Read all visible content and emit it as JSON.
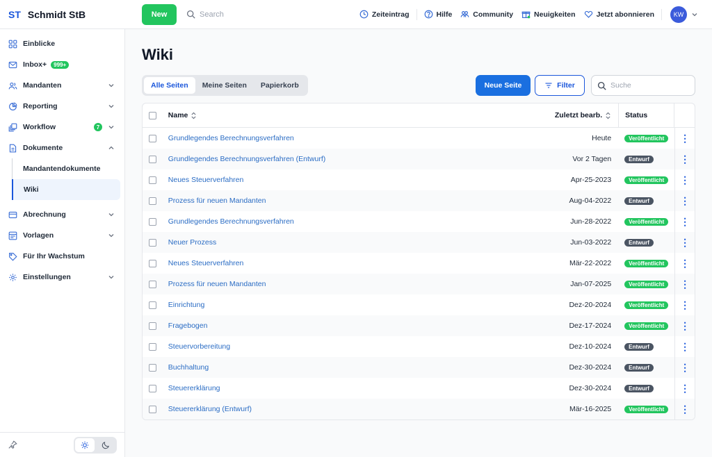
{
  "brand": {
    "abbr": "ST",
    "name": "Schmidt StB"
  },
  "topbar": {
    "new_label": "New",
    "search_placeholder": "Search",
    "links": [
      "Zeiteintrag",
      "Hilfe",
      "Community",
      "Neuigkeiten",
      "Jetzt abonnieren"
    ],
    "avatar": "KW"
  },
  "sidebar": {
    "items": [
      {
        "label": "Einblicke"
      },
      {
        "label": "Inbox+",
        "badge": "999+"
      },
      {
        "label": "Mandanten"
      },
      {
        "label": "Reporting"
      },
      {
        "label": "Workflow",
        "badge": "7"
      },
      {
        "label": "Dokumente"
      },
      {
        "label": "Abrechnung"
      },
      {
        "label": "Vorlagen"
      },
      {
        "label": "Für Ihr Wachstum"
      },
      {
        "label": "Einstellungen"
      }
    ],
    "sub_items": [
      "Mandantendokumente",
      "Wiki"
    ]
  },
  "page": {
    "title": "Wiki",
    "tabs": [
      "Alle Seiten",
      "Meine Seiten",
      "Papierkorb"
    ],
    "new_page": "Neue Seite",
    "filter": "Filter",
    "search_placeholder": "Suche"
  },
  "table": {
    "headers": {
      "name": "Name",
      "date": "Zuletzt bearb.",
      "status": "Status"
    },
    "rows": [
      {
        "name": "Grundlegendes Berechnungsverfahren",
        "date": "Heute",
        "status": "Veröffentlicht"
      },
      {
        "name": "Grundlegendes Berechnungsverfahren (Entwurf)",
        "date": "Vor 2 Tagen",
        "status": "Entwurf"
      },
      {
        "name": "Neues Steuerverfahren",
        "date": "Apr-25-2023",
        "status": "Veröffentlicht"
      },
      {
        "name": "Prozess für neuen Mandanten",
        "date": "Aug-04-2022",
        "status": "Entwurf"
      },
      {
        "name": "Grundlegendes Berechnungsverfahren",
        "date": "Jun-28-2022",
        "status": "Veröffentlicht"
      },
      {
        "name": "Neuer Prozess",
        "date": "Jun-03-2022",
        "status": "Entwurf"
      },
      {
        "name": "Neues Steuerverfahren",
        "date": "Mär-22-2022",
        "status": "Veröffentlicht"
      },
      {
        "name": "Prozess für neuen Mandanten",
        "date": "Jan-07-2025",
        "status": "Veröffentlicht"
      },
      {
        "name": "Einrichtung",
        "date": "Dez-20-2024",
        "status": "Veröffentlicht"
      },
      {
        "name": "Fragebogen",
        "date": "Dez-17-2024",
        "status": "Veröffentlicht"
      },
      {
        "name": "Steuervorbereitung",
        "date": "Dez-10-2024",
        "status": "Entwurf"
      },
      {
        "name": "Buchhaltung",
        "date": "Dez-30-2024",
        "status": "Entwurf"
      },
      {
        "name": "Steuererklärung",
        "date": "Dez-30-2024",
        "status": "Entwurf"
      },
      {
        "name": "Steuererklärung (Entwurf)",
        "date": "Mär-16-2025",
        "status": "Veröffentlicht"
      }
    ]
  },
  "colors": {
    "primary": "#1a6fe0",
    "success": "#22c55e",
    "draft": "#4b5563"
  }
}
